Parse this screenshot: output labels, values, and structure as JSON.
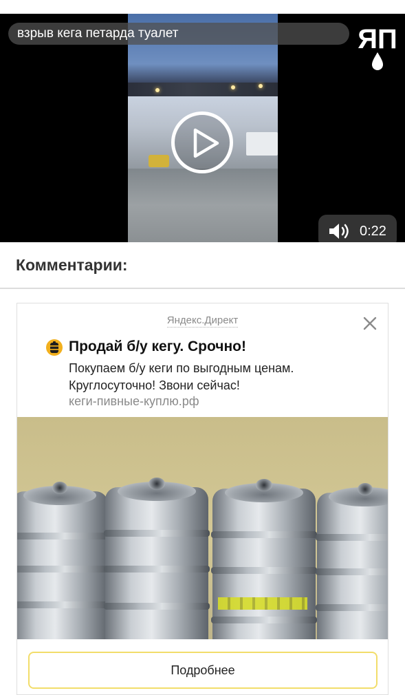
{
  "video": {
    "title": "взрыв кега петарда туалет",
    "logo_text": "ЯП",
    "duration": "0:22",
    "play_icon": "play-icon",
    "volume_icon": "volume-icon"
  },
  "comments": {
    "heading": "Комментарии:"
  },
  "ad": {
    "source_label": "Яндекс.Директ",
    "close_icon": "close-icon",
    "favicon_icon": "keg-icon",
    "title": "Продай б/у кегу. Срочно!",
    "text": "Покупаем б/у кеги по выгодным ценам. Круглосуточно! Звони сейчас!",
    "domain": "кеги-пивные-куплю.рф",
    "button_label": "Подробнее"
  },
  "colors": {
    "accent_button_border": "#f2dd6a",
    "favicon": "#f2b01e"
  }
}
